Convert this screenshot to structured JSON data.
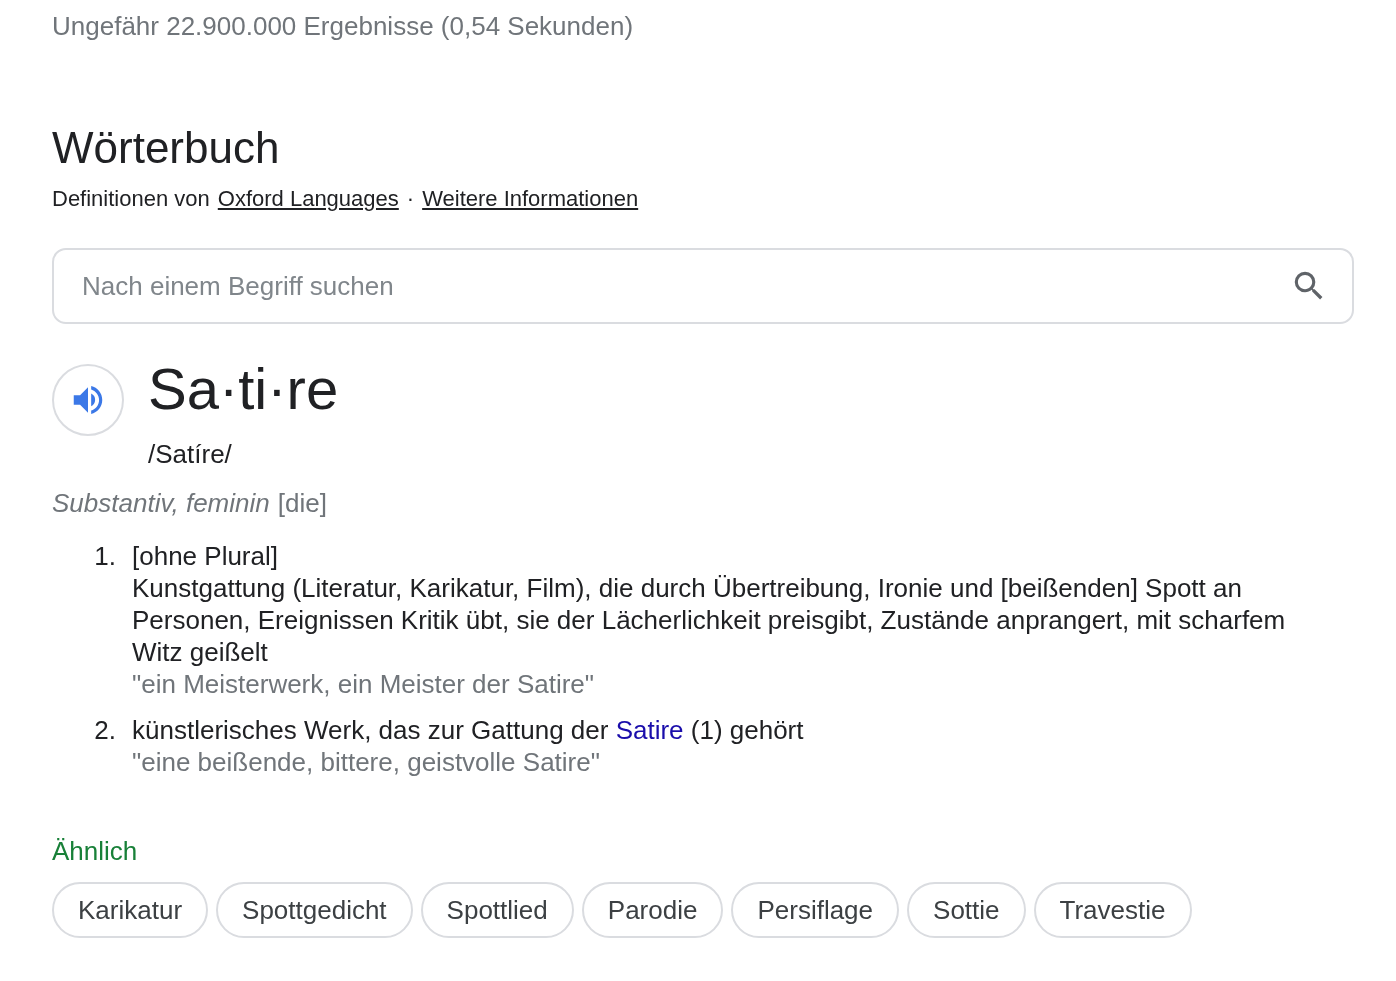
{
  "result_stats": "Ungefähr 22.900.000 Ergebnisse (0,54 Sekunden)",
  "dictionary": {
    "title": "Wörterbuch",
    "source_prefix": "Definitionen von",
    "source_link": "Oxford Languages",
    "separator": "·",
    "more_link": "Weitere Informationen",
    "search": {
      "placeholder": "Nach einem Begriff suchen"
    },
    "headword": "Sa·ti·re",
    "pronunciation": "/Satíre/",
    "grammar": {
      "word_class": "Substantiv, feminin",
      "article": "[die]"
    },
    "senses": [
      {
        "number": "1.",
        "label": "[ohne Plural]",
        "definition": [
          {
            "text": "Kunstgattung (Literatur, Karikatur, Film), die durch Übertreibung, Ironie und [beißenden] Spott an Personen, Ereignissen Kritik übt, sie der Lächerlichkeit preisgibt, Zustände anprangert, mit scharfem Witz geißelt",
            "kind": "plain"
          }
        ],
        "example": "\"ein Meisterwerk, ein Meister der Satire\""
      },
      {
        "number": "2.",
        "definition": [
          {
            "text": "künstlerisches Werk, das zur Gattung der ",
            "kind": "plain"
          },
          {
            "text": "Satire",
            "kind": "link"
          },
          {
            "text": " (1) gehört",
            "kind": "plain"
          }
        ],
        "example": "\"eine beißende, bittere, geistvolle Satire\""
      }
    ],
    "similar": {
      "title": "Ähnlich",
      "chips": [
        "Karikatur",
        "Spottgedicht",
        "Spottlied",
        "Parodie",
        "Persiflage",
        "Sottie",
        "Travestie"
      ]
    }
  }
}
